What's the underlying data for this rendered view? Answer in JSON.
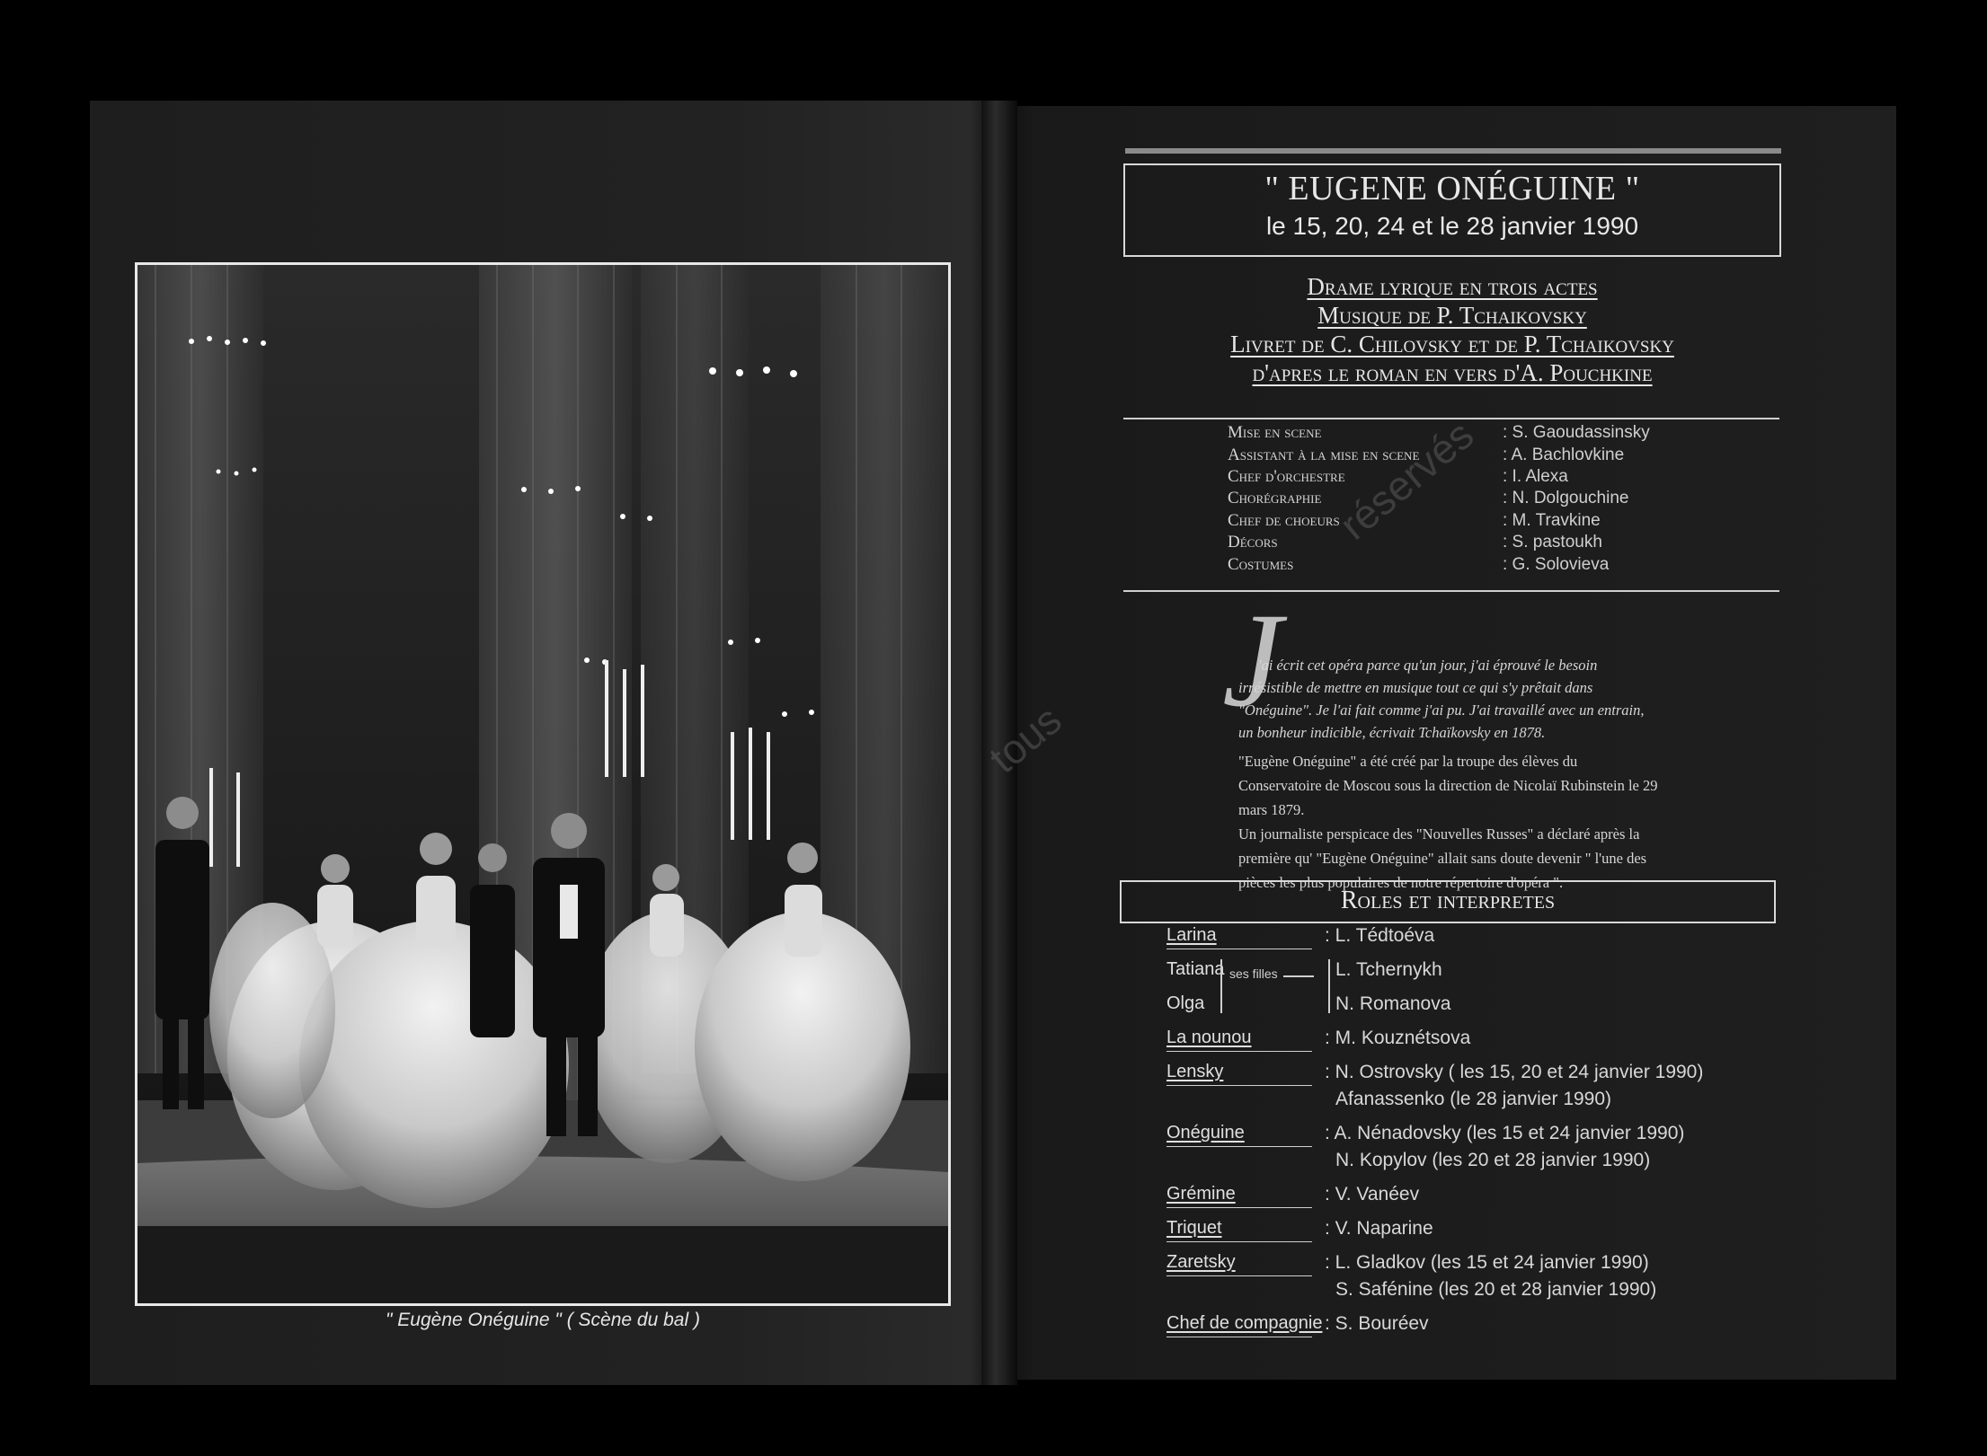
{
  "left_page": {
    "caption": "\" Eugène Onéguine \" ( Scène du bal )"
  },
  "right_page": {
    "title": "\" EUGENE ONÉGUINE \"",
    "dates": "le 15, 20, 24 et le 28 janvier 1990",
    "subtitles": [
      "Drame lyrique en trois actes",
      "Musique de P. Tchaikovsky",
      "Livret de C. Chilovsky et de P. Tchaikovsky",
      "d'apres le roman en vers d'A. Pouchkine"
    ],
    "credits": [
      {
        "role": "Mise en scene",
        "name": ": S. Gaoudassinsky"
      },
      {
        "role": "Assistant à la mise en scene",
        "name": ": A. Bachlovkine"
      },
      {
        "role": "Chef d'orchestre",
        "name": ": I. Alexa"
      },
      {
        "role": "Chorégraphie",
        "name": ": N. Dolgouchine"
      },
      {
        "role": "Chef de choeurs",
        "name": ": M. Travkine"
      },
      {
        "role": "Décors",
        "name": ": S. pastoukh"
      },
      {
        "role": "Costumes",
        "name": ": G. Solovieva"
      }
    ],
    "watermark": "réservés",
    "watermark2": "tous",
    "dropcap": "J",
    "quote": "'ai écrit cet opéra parce qu'un jour, j'ai éprouvé le besoin irrésistible de mettre en musique tout ce qui s'y prêtait dans \"Onéguine\". Je l'ai fait comme j'ai pu. J'ai travaillé avec un entrain, un bonheur indicible, écrivait Tchaïkovsky en 1878.",
    "paragraphs": [
      "\"Eugène Onéguine\" a été créé par la troupe des élèves du Conservatoire de Moscou sous la direction de Nicolaï Rubinstein le 29 mars 1879.",
      "Un journaliste perspicace des \"Nouvelles Russes\" a déclaré après la première qu' \"Eugène Onéguine\" allait sans doute devenir \" l'une des pièces les plus populaires de notre répertoire d'opéra \"."
    ],
    "roles_heading": "Roles et interpretes",
    "sisters_label": "ses filles",
    "cast": [
      {
        "role": "Larina",
        "actors": [
          ": L. Tédtoéva"
        ]
      },
      {
        "role": "Tatiana",
        "actors": [
          "L. Tchernykh"
        ]
      },
      {
        "role": "Olga",
        "actors": [
          "N. Romanova"
        ]
      },
      {
        "role": "La nounou",
        "actors": [
          ": M. Kouznétsova"
        ]
      },
      {
        "role": "Lensky",
        "actors": [
          ": N. Ostrovsky ( les 15, 20 et 24 janvier 1990)",
          "Afanassenko (le 28 janvier 1990)"
        ]
      },
      {
        "role": "Onéguine",
        "actors": [
          ": A. Nénadovsky (les 15 et 24 janvier 1990)",
          "N. Kopylov (les 20 et 28 janvier 1990)"
        ]
      },
      {
        "role": "Grémine",
        "actors": [
          ": V. Vanéev"
        ]
      },
      {
        "role": "Triquet",
        "actors": [
          ": V. Naparine"
        ]
      },
      {
        "role": "Zaretsky",
        "actors": [
          ": L. Gladkov (les 15 et 24 janvier 1990)",
          "S. Safénine (les 20 et 28 janvier 1990)"
        ]
      },
      {
        "role": "Chef de compagnie",
        "actors": [
          ": S. Bouréev"
        ]
      }
    ]
  }
}
